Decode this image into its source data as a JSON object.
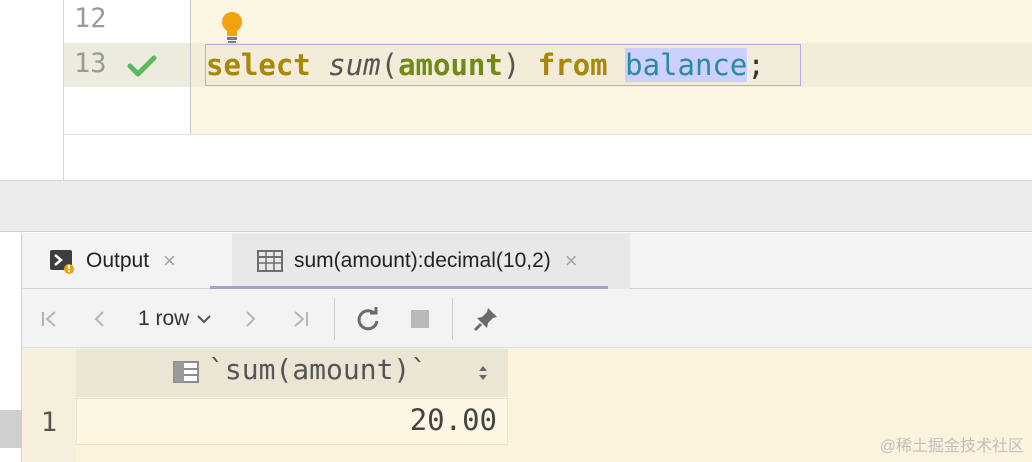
{
  "editor": {
    "line_numbers": [
      "12",
      "13"
    ],
    "code": {
      "kw_select": "select",
      "fn_sum": "sum",
      "paren_open": "(",
      "col_amount": "amount",
      "paren_close": ")",
      "kw_from": "from",
      "tbl_balance": "balance",
      "semicolon": ";"
    }
  },
  "results": {
    "tabs": [
      {
        "label": "Output",
        "close": "×"
      },
      {
        "label": "sum(amount):decimal(10,2)",
        "close": "×"
      }
    ],
    "toolbar": {
      "rows_label": "1 row"
    },
    "grid": {
      "column_header": "`sum(amount)`",
      "rows": [
        {
          "num": "1",
          "value": "20.00"
        }
      ]
    }
  },
  "watermark": "@稀土掘金技术社区",
  "colors": {
    "editor_bg": "#fdf6e3",
    "keyword": "#a8880a",
    "column": "#6f8a18",
    "table": "#2a8b9c",
    "check": "#5cb85c",
    "bulb": "#f0a30a"
  }
}
